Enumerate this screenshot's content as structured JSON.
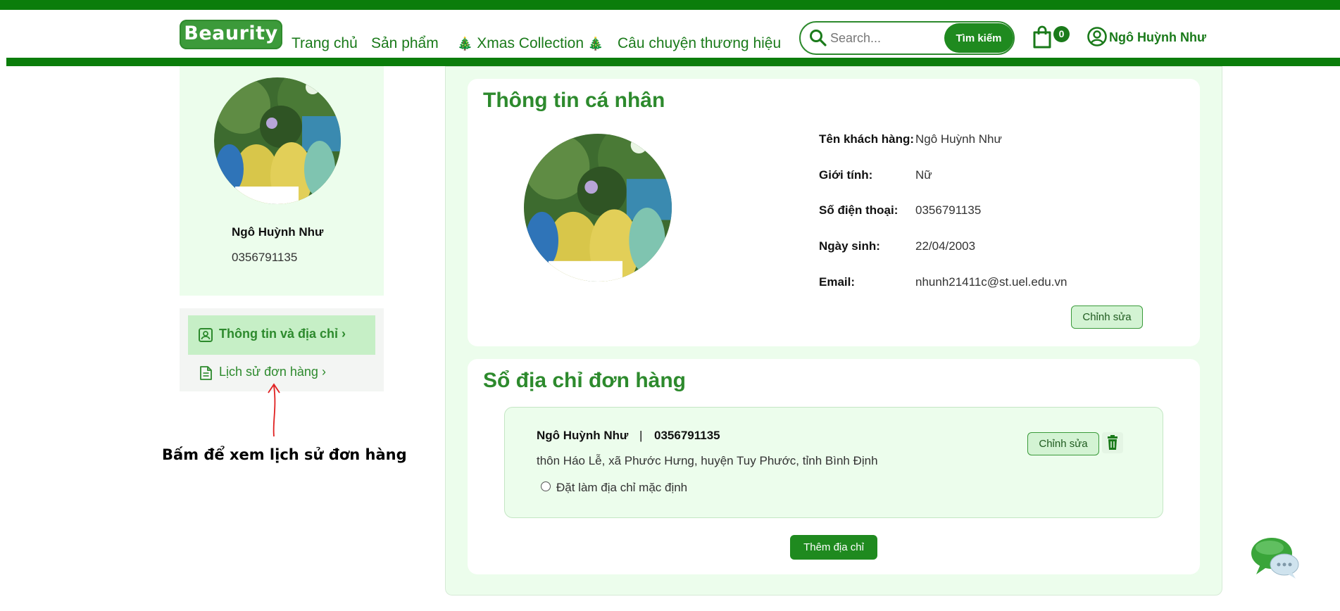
{
  "header": {
    "logo": "Beaurity",
    "nav": {
      "home": "Trang chủ",
      "products": "Sản phẩm",
      "xmas_tree": "🎄",
      "xmas": "Xmas Collection",
      "story": "Câu chuyện thương hiệu"
    },
    "search": {
      "placeholder": "Search...",
      "button": "Tìm kiếm",
      "icon": "search-icon"
    },
    "cart": {
      "icon": "shopping-bag-icon",
      "count": "0"
    },
    "user": {
      "icon": "user-circle-icon",
      "name": "Ngô Huỳnh Như"
    }
  },
  "sidebar": {
    "name": "Ngô Huỳnh Như",
    "phone": "0356791135",
    "menu": [
      {
        "label": "Thông tin và địa chỉ",
        "icon": "profile-card-icon",
        "active": true
      },
      {
        "label": "Lịch sử đơn hàng",
        "icon": "document-icon",
        "active": false
      }
    ],
    "annotation": "Bấm để xem lịch sử đơn hàng"
  },
  "profile": {
    "title": "Thông tin cá nhân",
    "fields": [
      {
        "label": "Tên khách hàng:",
        "value": "Ngô Huỳnh Như"
      },
      {
        "label": "Giới tính:",
        "value": "Nữ"
      },
      {
        "label": "Số điện thoại:",
        "value": "0356791135"
      },
      {
        "label": "Ngày sinh:",
        "value": "22/04/2003"
      },
      {
        "label": "Email:",
        "value": "nhunh21411c@st.uel.edu.vn"
      }
    ],
    "edit_button": "Chỉnh sửa"
  },
  "addresses": {
    "title": "Sổ địa chỉ đơn hàng",
    "items": [
      {
        "name": "Ngô Huỳnh Như",
        "separator": "|",
        "phone": "0356791135",
        "address": "thôn Háo Lễ, xã Phước Hưng, huyện Tuy Phước, tỉnh Bình Định",
        "default_label": "Đặt làm địa chỉ mặc định",
        "edit_button": "Chỉnh sửa",
        "delete_icon": "trash-icon"
      }
    ],
    "add_button": "Thêm địa chỉ"
  },
  "colors": {
    "brand_green": "#0b7d0b",
    "text_green": "#2d8a2d",
    "light_green_bg": "#ecfdec",
    "annotation_red": "#e02020"
  },
  "chat_icon": "chat-bubbles-icon"
}
